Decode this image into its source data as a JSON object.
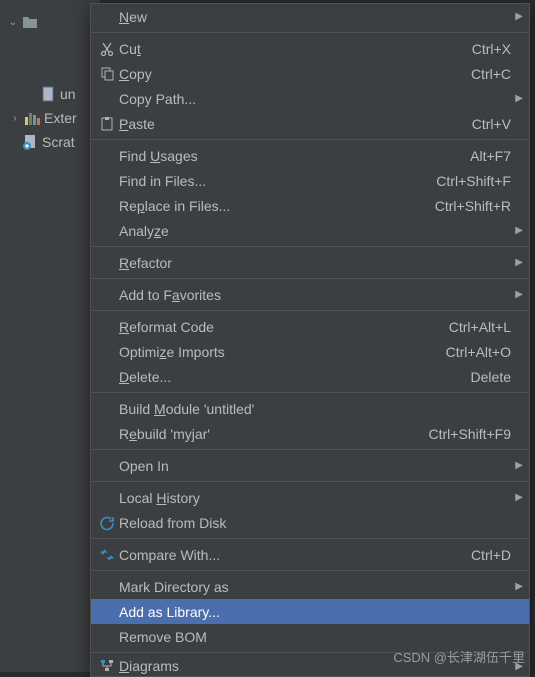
{
  "tree": {
    "top": {
      "label": ""
    },
    "untitled": {
      "label": "un"
    },
    "external": {
      "arrow": "›",
      "label": "Exter"
    },
    "scratches": {
      "label": "Scrat"
    }
  },
  "menu": {
    "new": {
      "label": "New",
      "mn": "N"
    },
    "cut": {
      "label": "Cut",
      "mn": "t",
      "shortcut": "Ctrl+X"
    },
    "copy": {
      "label": "Copy",
      "mn": "C",
      "shortcut": "Ctrl+C"
    },
    "copy_path": {
      "label": "Copy Path..."
    },
    "paste": {
      "label": "Paste",
      "mn": "P",
      "shortcut": "Ctrl+V"
    },
    "find_usages": {
      "label": "Find Usages",
      "mn": "U",
      "shortcut": "Alt+F7"
    },
    "find_in_files": {
      "label": "Find in Files..."
    },
    "replace_in_files": {
      "label": "Replace in Files...",
      "mn": "p",
      "shortcut": "Ctrl+Shift+R"
    },
    "find_in_files_shortcut": "Ctrl+Shift+F",
    "analyze": {
      "label": "Analyze",
      "mn": "z"
    },
    "refactor": {
      "label": "Refactor",
      "mn": "R"
    },
    "favorites": {
      "label": "Add to Favorites",
      "mn": "a"
    },
    "reformat": {
      "label": "Reformat Code",
      "mn": "R",
      "shortcut": "Ctrl+Alt+L"
    },
    "optimize": {
      "label": "Optimize Imports",
      "mn": "z",
      "shortcut": "Ctrl+Alt+O"
    },
    "delete": {
      "label": "Delete...",
      "mn": "D",
      "shortcut": "Delete"
    },
    "build_module": {
      "label": "Build Module 'untitled'",
      "mn": "M"
    },
    "rebuild": {
      "label": "Rebuild 'myjar'",
      "mn": "e",
      "shortcut": "Ctrl+Shift+F9"
    },
    "open_in": {
      "label": "Open In"
    },
    "local_history": {
      "label": "Local History",
      "mn": "H"
    },
    "reload": {
      "label": "Reload from Disk"
    },
    "compare": {
      "label": "Compare With...",
      "shortcut": "Ctrl+D"
    },
    "mark_dir": {
      "label": "Mark Directory as"
    },
    "add_library": {
      "label": "Add as Library..."
    },
    "remove_bom": {
      "label": "Remove BOM"
    },
    "diagrams": {
      "label": "Diagrams",
      "mn": "D"
    }
  },
  "watermark": "CSDN @长津湖伍千里"
}
